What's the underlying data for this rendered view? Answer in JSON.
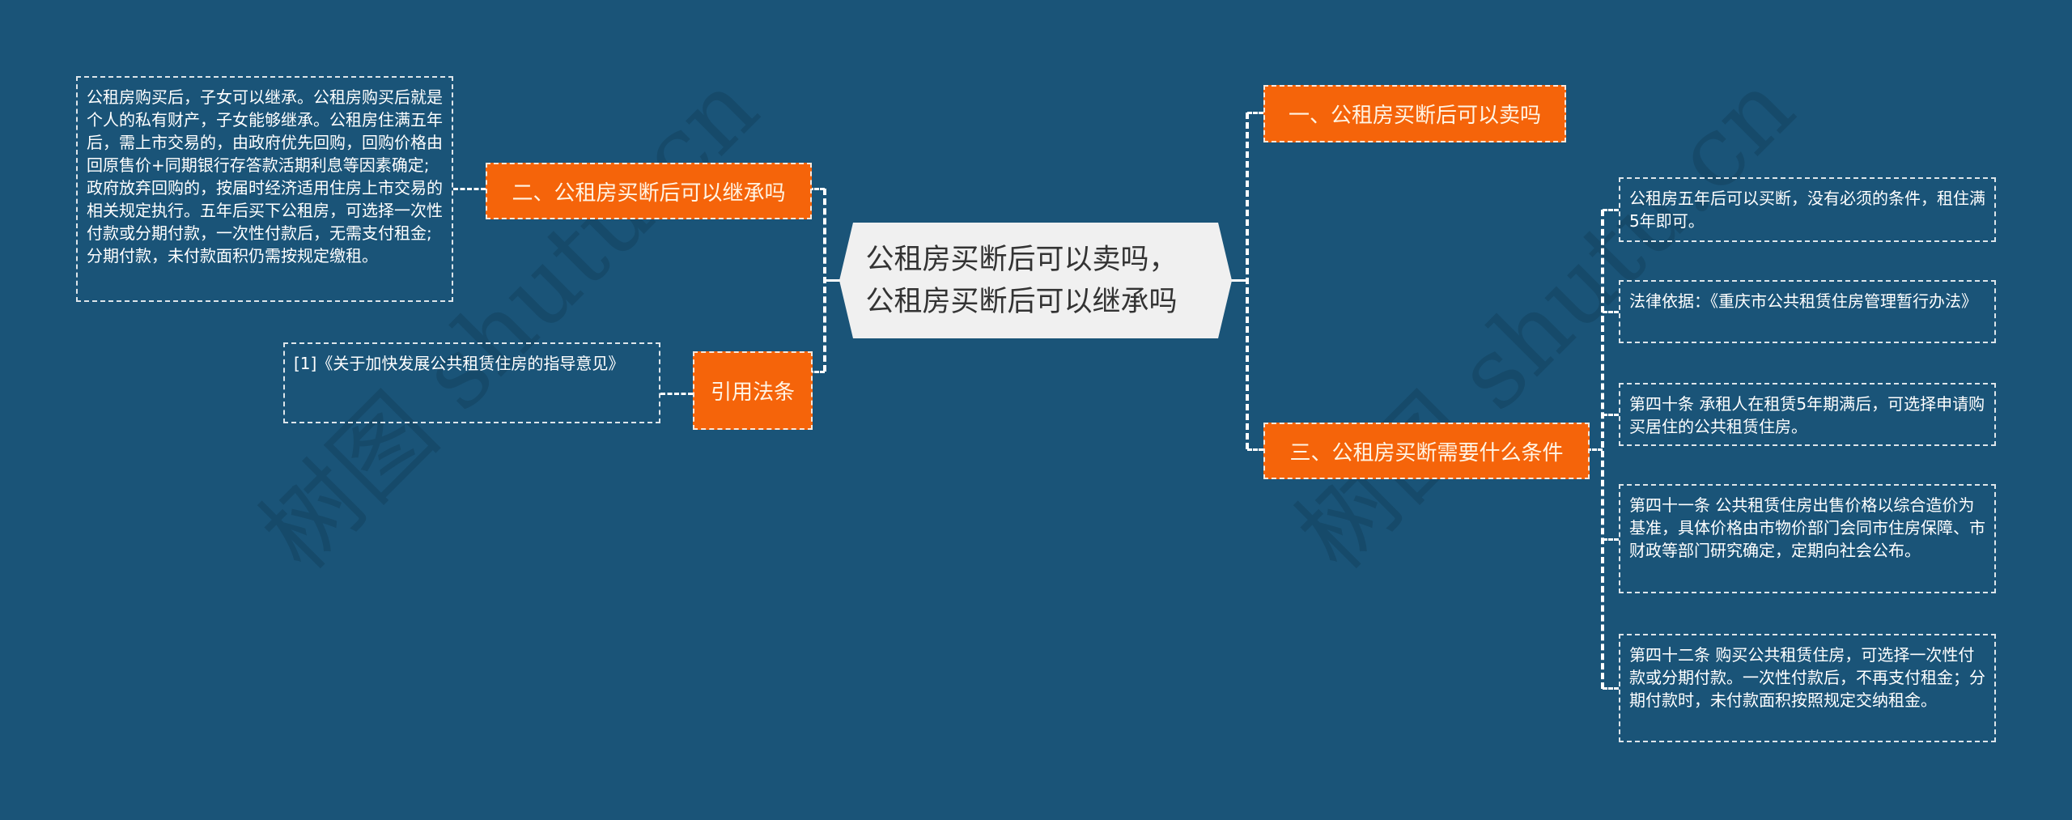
{
  "watermark": {
    "left": "树图 shutu.cn",
    "right": "树图 shutu.cn"
  },
  "root": {
    "line1": "公租房买断后可以卖吗，",
    "line2": "公租房买断后可以继承吗"
  },
  "branches": {
    "b1": {
      "label": "一、公租房买断后可以卖吗"
    },
    "b2": {
      "label": "二、公租房买断后可以继承吗",
      "detail": "公租房购买后，子女可以继承。公租房购买后就是个人的私有财产，子女能够继承。公租房住满五年后，需上市交易的，由政府优先回购，回购价格由回原售价+同期银行存答款活期利息等因素确定;政府放弃回购的，按届时经济适用住房上市交易的相关规定执行。五年后买下公租房，可选择一次性付款或分期付款，一次性付款后，无需支付租金;分期付款，未付款面积仍需按规定缴租。"
    },
    "b3": {
      "label": "三、公租房买断需要什么条件",
      "children": [
        "公租房五年后可以买断，没有必须的条件，租住满5年即可。",
        "法律依据：《重庆市公共租赁住房管理暂行办法》",
        "第四十条 承租人在租赁5年期满后，可选择申请购买居住的公共租赁住房。",
        "第四十一条 公共租赁住房出售价格以综合造价为基准，具体价格由市物价部门会同市住房保障、市财政等部门研究确定，定期向社会公布。",
        "第四十二条 购买公共租赁住房，可选择一次性付款或分期付款。一次性付款后，不再支付租金；分期付款时，未付款面积按照规定交纳租金。"
      ]
    },
    "cite": {
      "label": "引用法条",
      "detail": "[1]《关于加快发展公共租赁住房的指导意见》"
    }
  },
  "colors": {
    "background": "#1a5478",
    "branch": "#f5640a",
    "root": "#f0f0f0"
  }
}
